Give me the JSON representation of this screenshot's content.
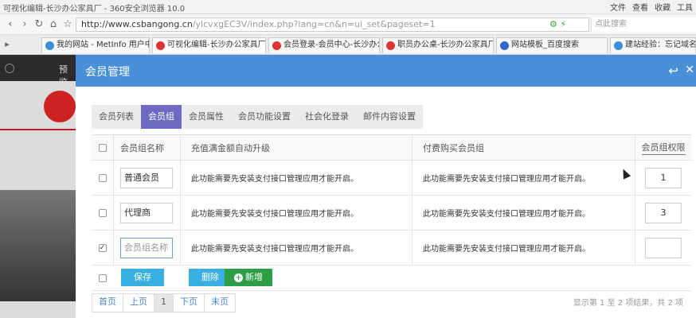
{
  "browser": {
    "window_title": "可视化编辑-长沙办公家具厂 - 360安全浏览器 10.0",
    "menu": [
      "文件",
      "查看",
      "收藏",
      "工具"
    ],
    "url_host": "http://www.csbangong.cn",
    "url_path": "/ylcvxgEC3V/index.php?lang=cn&n=ui_set&pageset=1",
    "search_placeholder": "点此搜索",
    "tabs": [
      {
        "label": "我的网站 - MetInfo 用户中",
        "color": "#3b8fd9"
      },
      {
        "label": "可视化编辑-长沙办公家具厂",
        "color": "#d33"
      },
      {
        "label": "会员登录-会员中心-长沙办公",
        "color": "#d33"
      },
      {
        "label": "职员办公桌-长沙办公家具厂",
        "color": "#d33"
      },
      {
        "label": "网站模板_百度搜索",
        "color": "#3366cc"
      },
      {
        "label": "建站经验：忘记域名是",
        "color": "#3b8fd9"
      }
    ]
  },
  "bg": {
    "nav_text": "预览"
  },
  "modal": {
    "title": "会员管理",
    "subtabs": [
      "会员列表",
      "会员组",
      "会员属性",
      "会员功能设置",
      "社会化登录",
      "邮件内容设置"
    ],
    "active_subtab": 1,
    "table": {
      "headers": {
        "name": "会员组名称",
        "upgrade": "充值满金额自动升级",
        "buy": "付费购买会员组",
        "perm": "会员组权限"
      },
      "rows": [
        {
          "checked": false,
          "name": "普通会员",
          "upgrade": "此功能需要先安装支付接口管理应用才能开启。",
          "buy": "此功能需要先安装支付接口管理应用才能开启。",
          "perm": "1"
        },
        {
          "checked": false,
          "name": "代理商",
          "upgrade": "此功能需要先安装支付接口管理应用才能开启。",
          "buy": "此功能需要先安装支付接口管理应用才能开启。",
          "perm": "3"
        },
        {
          "checked": true,
          "name": "",
          "name_placeholder": "会员组名称",
          "upgrade": "此功能需要先安装支付接口管理应用才能开启。",
          "buy": "此功能需要先安装支付接口管理应用才能开启。",
          "perm": ""
        }
      ]
    },
    "buttons": {
      "save": "保存",
      "delete": "删除",
      "add": "新增"
    },
    "pager": {
      "items": [
        "首页",
        "上页",
        "1",
        "下页",
        "末页"
      ],
      "info": "显示第 1 至 2 项结果，共 2 项"
    }
  }
}
